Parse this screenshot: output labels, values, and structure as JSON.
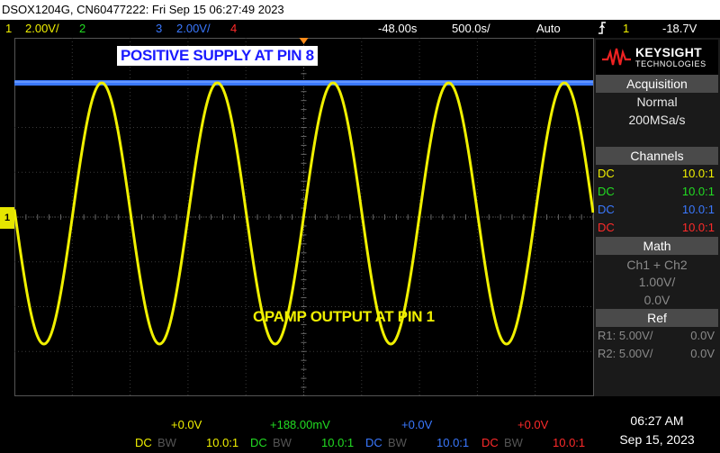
{
  "title_bar": "DSOX1204G, CN60477222: Fri Sep 15 06:27:49 2023",
  "status": {
    "ch1_num": "1",
    "ch1_scale": "2.00V/",
    "ch2_num": "2",
    "ch3_num": "3",
    "ch3_scale": "2.00V/",
    "ch4_num": "4",
    "delay": "-48.00s",
    "timebase": "500.0s/",
    "trigger_mode": "Auto",
    "trigger_icon": "trigger-edge-icon",
    "trigger_source": "1",
    "trigger_level": "-18.7V"
  },
  "logo": {
    "brand": "KEYSIGHT",
    "sub": "TECHNOLOGIES"
  },
  "acquisition": {
    "header": "Acquisition",
    "mode": "Normal",
    "rate": "200MSa/s"
  },
  "channels": {
    "header": "Channels",
    "rows": [
      {
        "coupling": "DC",
        "probe": "10.0:1",
        "color": "#f0f000"
      },
      {
        "coupling": "DC",
        "probe": "10.0:1",
        "color": "#22dd22"
      },
      {
        "coupling": "DC",
        "probe": "10.0:1",
        "color": "#3a78ff"
      },
      {
        "coupling": "DC",
        "probe": "10.0:1",
        "color": "#ff2a2a"
      }
    ]
  },
  "math": {
    "header": "Math",
    "expr": "Ch1 + Ch2",
    "scale": "1.00V/",
    "offset": "0.0V"
  },
  "ref": {
    "header": "Ref",
    "r1_label": "R1:",
    "r1_scale": "5.00V/",
    "r1_offset": "0.0V",
    "r2_label": "R2:",
    "r2_scale": "5.00V/",
    "r2_offset": "0.0V"
  },
  "annotations": {
    "banner": "POSITIVE SUPPLY AT PIN 8",
    "label": "OPAMP OUTPUT AT PIN 1"
  },
  "bottom_channels": [
    {
      "offset": "+0.0V",
      "coupling": "DC",
      "bw": "BW",
      "probe": "10.0:1",
      "color": "#f0f000"
    },
    {
      "offset": "+188.00mV",
      "coupling": "DC",
      "bw": "BW",
      "probe": "10.0:1",
      "color": "#22dd22"
    },
    {
      "offset": "+0.0V",
      "coupling": "DC",
      "bw": "BW",
      "probe": "10.0:1",
      "color": "#3a78ff"
    },
    {
      "offset": "+0.0V",
      "coupling": "DC",
      "bw": "BW",
      "probe": "10.0:1",
      "color": "#ff2a2a"
    }
  ],
  "clock": {
    "time": "06:27 AM",
    "date": "Sep 15, 2023"
  },
  "ch1_marker": "1",
  "colors": {
    "ch1": "#f0f000",
    "ch2": "#22dd22",
    "ch3": "#3a78ff",
    "ch4": "#ff2a2a",
    "trigger": "#ff8c1a"
  }
}
